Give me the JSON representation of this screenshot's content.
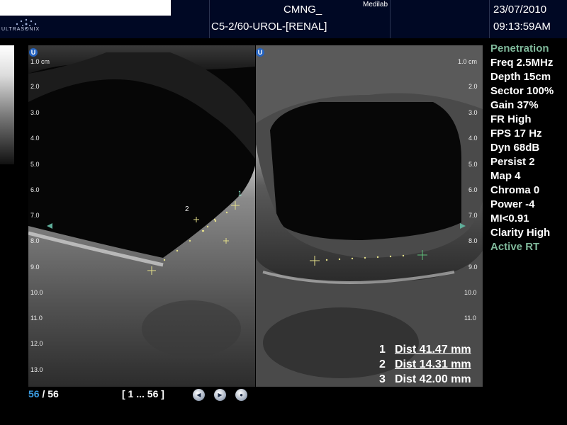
{
  "header": {
    "patient_name": "",
    "logo_text": "ULTRASONIX",
    "facility": "CMNG_",
    "brand": "Medilab",
    "preset": "C5-2/60-UROL-[RENAL]",
    "date": "23/07/2010",
    "time": "09:13:59AM"
  },
  "images": {
    "left": {
      "badge": "U",
      "depth_labels": [
        "1.0 cm",
        "2.0",
        "3.0",
        "4.0",
        "5.0",
        "6.0",
        "7.0",
        "8.0",
        "9.0",
        "10.0",
        "11.0",
        "12.0",
        "13.0"
      ],
      "caliper_labels": [
        "1",
        "2"
      ]
    },
    "right": {
      "badge": "U",
      "depth_labels": [
        "1.0 cm",
        "2.0",
        "3.0",
        "4.0",
        "5.0",
        "6.0",
        "7.0",
        "8.0",
        "9.0",
        "10.0",
        "11.0"
      ]
    }
  },
  "params": [
    {
      "text": "Penetration",
      "color": "#7fb89a"
    },
    {
      "text": "Freq 2.5MHz"
    },
    {
      "text": "Depth 15cm"
    },
    {
      "text": "Sector 100%"
    },
    {
      "text": "Gain 37%"
    },
    {
      "text": "FR High"
    },
    {
      "text": "FPS 17 Hz"
    },
    {
      "text": "Dyn 68dB"
    },
    {
      "text": "Persist 2"
    },
    {
      "text": "Map 4"
    },
    {
      "text": "Chroma 0"
    },
    {
      "text": "Power -4"
    },
    {
      "text": "MI<0.91"
    },
    {
      "text": "Clarity High"
    },
    {
      "text": "Active RT",
      "color": "#7fb89a"
    }
  ],
  "measurements": [
    {
      "num": "1",
      "text": "Dist 41.47 mm"
    },
    {
      "num": "2",
      "text": "Dist 14.31 mm"
    },
    {
      "num": "3",
      "text": "Dist 42.00 mm"
    }
  ],
  "footer": {
    "frame_current": "56",
    "frame_total": "/ 56",
    "frame_range": "[ 1 ... 56 ]",
    "controls": {
      "prev": "◀",
      "play": "▶",
      "stop": "●"
    },
    "frame_color": "#3a9be0"
  }
}
